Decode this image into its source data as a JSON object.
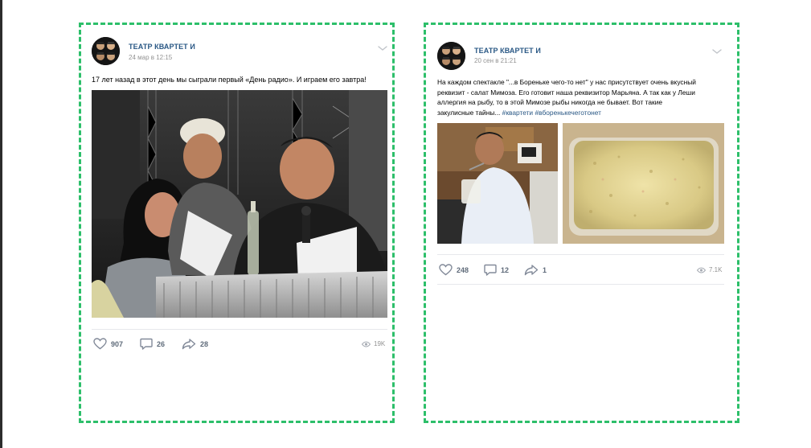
{
  "posts": [
    {
      "author": "ТЕАТР КВАРТЕТ И",
      "date": "24 мар в 12:15",
      "text": "17 лет назад в этот день мы сыграли первый «День радио». И играем его завтра!",
      "likes": "907",
      "comments": "26",
      "shares": "28",
      "views": "19K"
    },
    {
      "author": "ТЕАТР КВАРТЕТ И",
      "date": "20 сен в 21:21",
      "text_lines": [
        "На каждом спектакле \"...в Бореньке чего-то нет\" у нас присутствует очень вкусный",
        "реквизит - салат Мимоза. Его готовит наша реквизитор Марьяна. А так как у Леши",
        "аллергия на рыбу, то в этой Мимозе рыбы никогда не бывает. Вот такие",
        "закулисные тайны..."
      ],
      "hashtags": "#квартети #вбореньке­чеготонет",
      "likes": "248",
      "comments": "12",
      "shares": "1",
      "views": "7.1K"
    }
  ],
  "icons": {
    "like": "heart-icon",
    "comment": "comment-icon",
    "share": "share-icon",
    "views": "eye-icon",
    "more": "chevron-down-icon"
  },
  "colors": {
    "dashed_border": "#2dbf6a",
    "author_link": "#2a5885",
    "meta_gray": "#939393"
  }
}
